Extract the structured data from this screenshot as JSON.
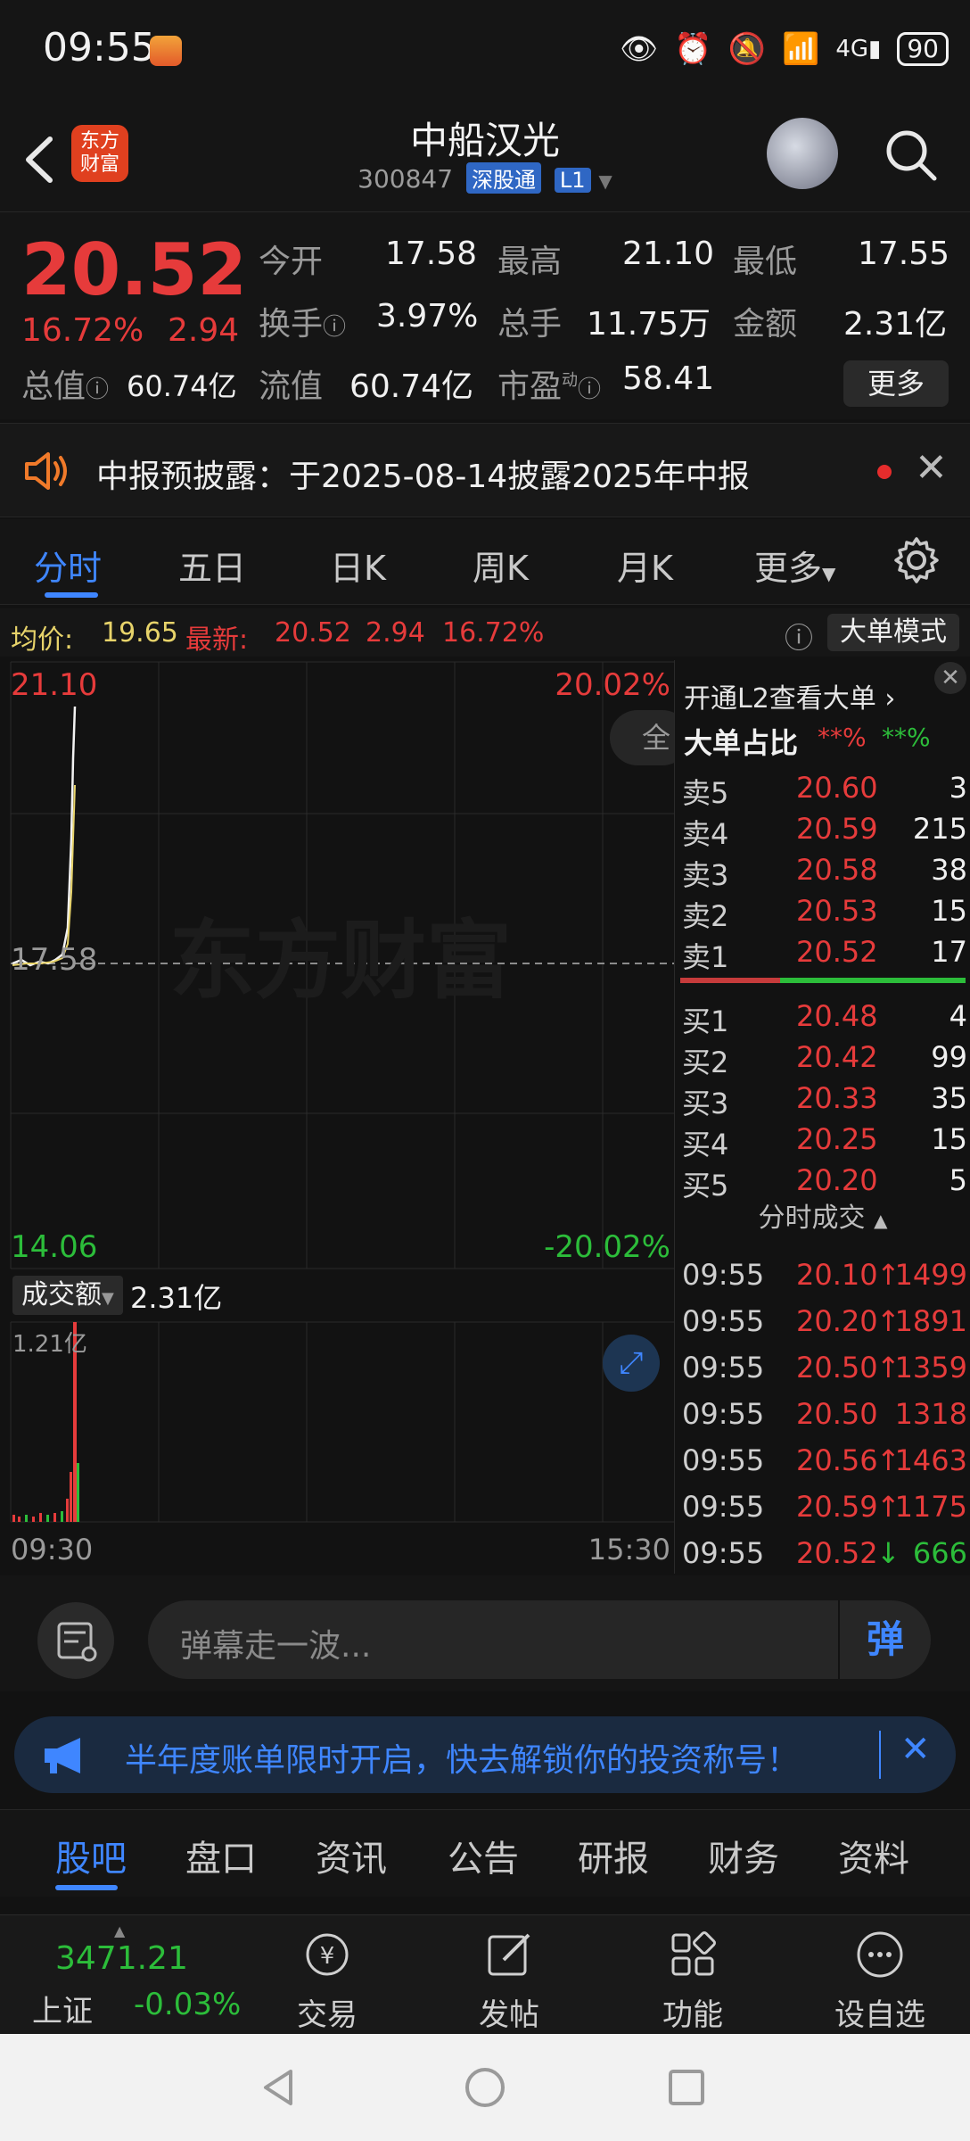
{
  "status_bar": {
    "time": "09:55",
    "battery": "90"
  },
  "header": {
    "logo_text": "东方财富",
    "stock_name": "中船汉光",
    "stock_code": "300847",
    "market_tag": "深股通",
    "level_tag": "L1"
  },
  "quote": {
    "price": "20.52",
    "change_pct": "16.72%",
    "change": "2.94",
    "open_label": "今开",
    "open": "17.58",
    "high_label": "最高",
    "high": "21.10",
    "low_label": "最低",
    "low": "17.55",
    "turnover_label": "换手",
    "turnover": "3.97%",
    "volume_label": "总手",
    "volume": "11.75万",
    "amount_label": "金额",
    "amount": "2.31亿",
    "mktcap_label": "总值",
    "mktcap": "60.74亿",
    "float_label": "流值",
    "float_cap": "60.74亿",
    "pe_label": "市盈",
    "pe_sup": "动",
    "pe": "58.41",
    "more": "更多"
  },
  "notice": {
    "text": "中报预披露：于2025-08-14披露2025年中报"
  },
  "tabs": [
    "分时",
    "五日",
    "日K",
    "周K",
    "月K",
    "更多"
  ],
  "strip": {
    "avg_label": "均价:",
    "avg": "19.65",
    "latest_label": "最新:",
    "latest": "20.52",
    "latest_chg": "2.94",
    "latest_pct": "16.72%",
    "big_mode": "大单模式"
  },
  "chart": {
    "max_price": "21.10",
    "max_pct": "20.02%",
    "mid_price": "17.58",
    "min_price": "14.06",
    "min_pct": "-20.02%",
    "full_btn": "全",
    "watermark": "东方财富",
    "vol_label": "成交额",
    "vol_value": "2.31亿",
    "vol_max": "1.21亿",
    "time_start": "09:30",
    "time_end": "15:30"
  },
  "orderbook": {
    "l2_prompt": "开通L2查看大单",
    "big_ratio_label": "大单占比",
    "big_red": "**%",
    "big_green": "**%",
    "asks": [
      {
        "label": "卖5",
        "price": "20.60",
        "qty": "3"
      },
      {
        "label": "卖4",
        "price": "20.59",
        "qty": "215"
      },
      {
        "label": "卖3",
        "price": "20.58",
        "qty": "38"
      },
      {
        "label": "卖2",
        "price": "20.53",
        "qty": "15"
      },
      {
        "label": "卖1",
        "price": "20.52",
        "qty": "17"
      }
    ],
    "bids": [
      {
        "label": "买1",
        "price": "20.48",
        "qty": "4"
      },
      {
        "label": "买2",
        "price": "20.42",
        "qty": "99"
      },
      {
        "label": "买3",
        "price": "20.33",
        "qty": "35"
      },
      {
        "label": "买4",
        "price": "20.25",
        "qty": "15"
      },
      {
        "label": "买5",
        "price": "20.20",
        "qty": "5"
      }
    ],
    "trades_title": "分时成交",
    "trades": [
      {
        "time": "09:55",
        "price": "20.10",
        "dir": "↑",
        "qty": "1499",
        "up": true
      },
      {
        "time": "09:55",
        "price": "20.20",
        "dir": "↑",
        "qty": "1891",
        "up": true
      },
      {
        "time": "09:55",
        "price": "20.50",
        "dir": "↑",
        "qty": "1359",
        "up": true
      },
      {
        "time": "09:55",
        "price": "20.50",
        "dir": "",
        "qty": "1318",
        "up": true
      },
      {
        "time": "09:55",
        "price": "20.56",
        "dir": "↑",
        "qty": "1463",
        "up": true
      },
      {
        "time": "09:55",
        "price": "20.59",
        "dir": "↑",
        "qty": "1175",
        "up": true
      },
      {
        "time": "09:55",
        "price": "20.52",
        "dir": "↓",
        "qty": "666",
        "up": false
      }
    ]
  },
  "danmu": {
    "placeholder": "弹幕走一波...",
    "send": "弹"
  },
  "banner": {
    "text": "半年度账单限时开启，快去解锁你的投资称号！"
  },
  "subtabs": [
    "股吧",
    "盘口",
    "资讯",
    "公告",
    "研报",
    "财务",
    "资料"
  ],
  "bottom_nav": {
    "index_value": "3471.21",
    "index_name": "上证",
    "index_pct": "-0.03%",
    "items": [
      "交易",
      "发帖",
      "功能",
      "设自选"
    ]
  },
  "colors": {
    "up": "#e63b3b",
    "down": "#2cbd3a",
    "accent": "#3f86ff",
    "background": "#121212"
  }
}
